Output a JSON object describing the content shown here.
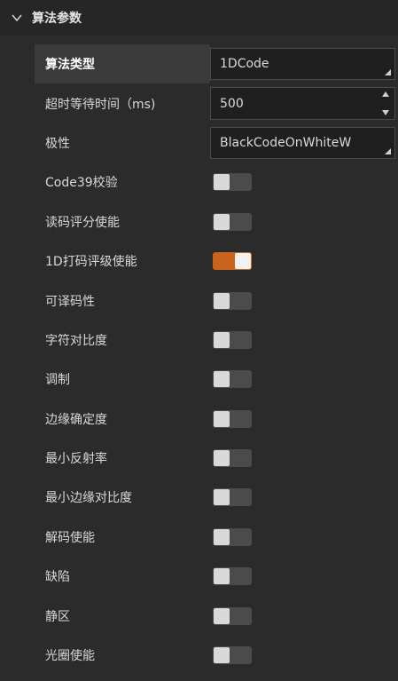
{
  "section": {
    "title": "算法参数"
  },
  "params": [
    {
      "label": "算法类型",
      "type": "dropdown",
      "value": "1DCode",
      "selected": true
    },
    {
      "label": "超时等待时间（ms)",
      "type": "number",
      "value": "500"
    },
    {
      "label": "极性",
      "type": "dropdown",
      "value": "BlackCodeOnWhiteW"
    },
    {
      "label": "Code39校验",
      "type": "toggle",
      "on": false
    },
    {
      "label": "读码评分使能",
      "type": "toggle",
      "on": false
    },
    {
      "label": "1D打码评级使能",
      "type": "toggle",
      "on": true
    },
    {
      "label": "可译码性",
      "type": "toggle",
      "on": false
    },
    {
      "label": "字符对比度",
      "type": "toggle",
      "on": false
    },
    {
      "label": "调制",
      "type": "toggle",
      "on": false
    },
    {
      "label": "边缘确定度",
      "type": "toggle",
      "on": false
    },
    {
      "label": "最小反射率",
      "type": "toggle",
      "on": false
    },
    {
      "label": "最小边缘对比度",
      "type": "toggle",
      "on": false
    },
    {
      "label": "解码使能",
      "type": "toggle",
      "on": false
    },
    {
      "label": "缺陷",
      "type": "toggle",
      "on": false
    },
    {
      "label": "静区",
      "type": "toggle",
      "on": false
    },
    {
      "label": "光圈使能",
      "type": "toggle",
      "on": false
    }
  ],
  "colors": {
    "toggle_on": "#c8641b",
    "toggle_off": "#4b4b4b",
    "background": "#2b2b2b"
  }
}
